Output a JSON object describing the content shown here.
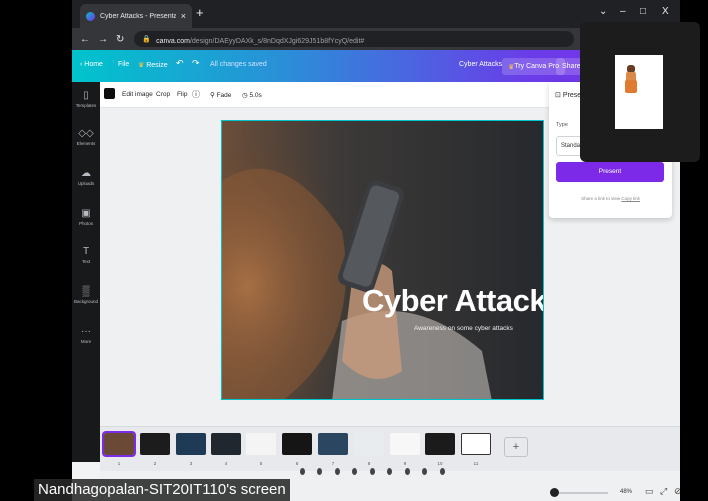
{
  "browser": {
    "tab_title": "Cyber Attacks - Presentation",
    "tab_close": "×",
    "new_tab": "+",
    "window_controls": [
      "⌄",
      "–",
      "□",
      "X"
    ],
    "url_domain": "canva.com",
    "url_path": "/design/DAEyyDAXk_s/8nDqdXJgi629J51b8fYcyQ/edit#"
  },
  "header": {
    "home": "Home",
    "file": "File",
    "resize": "Resize",
    "saved_status": "All changes saved",
    "doc_title": "Cyber Attacks",
    "try_pro": "Try Canva Pro",
    "share": "Share"
  },
  "sidebar": {
    "items": [
      {
        "label": "Templates",
        "icon": "templates-icon",
        "glyph": "▯"
      },
      {
        "label": "Elements",
        "icon": "elements-icon",
        "glyph": "◇◇"
      },
      {
        "label": "Uploads",
        "icon": "uploads-icon",
        "glyph": "☁"
      },
      {
        "label": "Photos",
        "icon": "photos-icon",
        "glyph": "▣"
      },
      {
        "label": "Text",
        "icon": "text-icon",
        "glyph": "T"
      },
      {
        "label": "Background",
        "icon": "background-icon",
        "glyph": "▒"
      },
      {
        "label": "More",
        "icon": "more-icon",
        "glyph": "···"
      }
    ]
  },
  "toolbar": {
    "edit_image": "Edit image",
    "crop": "Crop",
    "flip": "Flip",
    "info": "ⓘ",
    "fade": "Fade",
    "duration": "5.0s"
  },
  "slide": {
    "title": "Cyber Attacks",
    "subtitle": "Awareness on some cyber attacks"
  },
  "present_panel": {
    "heading": "Prese",
    "type_label": "Type",
    "type_value": "Standa",
    "present_button": "Present",
    "link_text": "Share a link to view",
    "link_anchor": "Copy link"
  },
  "thumbnails": {
    "numbers": [
      "1",
      "2",
      "3",
      "4",
      "5",
      "6",
      "7",
      "8",
      "9",
      "10",
      "11"
    ],
    "selected_index": 0,
    "add_label": "+"
  },
  "status": {
    "zoom": "48%"
  },
  "caption": {
    "text": "Nandhagopalan-SIT20IT110's screen"
  },
  "colors": {
    "accent": "#7d2ae8",
    "header_start": "#00c4cc",
    "header_end": "#7d2ae8"
  }
}
